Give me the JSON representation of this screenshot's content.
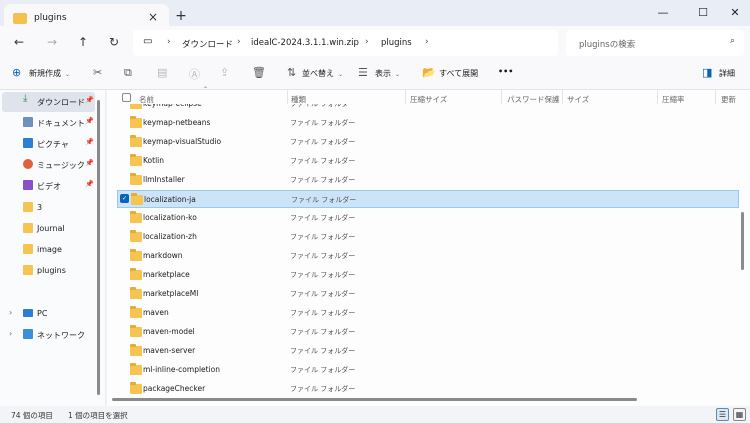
{
  "window": {
    "tab_title": "plugins",
    "tab_close": "×",
    "new_tab": "+",
    "minimize": "—",
    "maximize": "☐",
    "close": "✕"
  },
  "nav": {
    "back": "←",
    "forward": "→",
    "up": "↑",
    "refresh": "↻"
  },
  "address": {
    "crumbs": [
      "ダウンロード",
      "idealC-2024.3.1.1.win.zip",
      "plugins"
    ],
    "search_placeholder": "pluginsの検索"
  },
  "toolbar": {
    "new_label": "新規作成",
    "sort_label": "並べ替え",
    "view_label": "表示",
    "expand_all_label": "すべて展開",
    "more_label": "•••",
    "details_label": "詳細"
  },
  "sidebar": {
    "items": [
      {
        "label": "ダウンロード",
        "pinned": true
      },
      {
        "label": "ドキュメント",
        "pinned": true
      },
      {
        "label": "ピクチャ",
        "pinned": true
      },
      {
        "label": "ミュージック",
        "pinned": true
      },
      {
        "label": "ビデオ",
        "pinned": true
      },
      {
        "label": "3",
        "pinned": false
      },
      {
        "label": "Journal",
        "pinned": false
      },
      {
        "label": "image",
        "pinned": false
      },
      {
        "label": "plugins",
        "pinned": false
      },
      {
        "label": "PC",
        "pinned": false
      },
      {
        "label": "ネットワーク",
        "pinned": false
      }
    ]
  },
  "columns": [
    "名前",
    "種類",
    "圧縮サイズ",
    "パスワード保護",
    "サイズ",
    "圧縮率",
    "更新"
  ],
  "files": [
    {
      "name": "keymap-eclipse",
      "type": "ファイル フォルダー"
    },
    {
      "name": "keymap-netbeans",
      "type": "ファイル フォルダー"
    },
    {
      "name": "keymap-visualStudio",
      "type": "ファイル フォルダー"
    },
    {
      "name": "Kotlin",
      "type": "ファイル フォルダー"
    },
    {
      "name": "llmInstaller",
      "type": "ファイル フォルダー"
    },
    {
      "name": "localization-ja",
      "type": "ファイル フォルダー"
    },
    {
      "name": "localization-ko",
      "type": "ファイル フォルダー"
    },
    {
      "name": "localization-zh",
      "type": "ファイル フォルダー"
    },
    {
      "name": "markdown",
      "type": "ファイル フォルダー"
    },
    {
      "name": "marketplace",
      "type": "ファイル フォルダー"
    },
    {
      "name": "marketplaceMl",
      "type": "ファイル フォルダー"
    },
    {
      "name": "maven",
      "type": "ファイル フォルダー"
    },
    {
      "name": "maven-model",
      "type": "ファイル フォルダー"
    },
    {
      "name": "maven-server",
      "type": "ファイル フォルダー"
    },
    {
      "name": "ml-inline-completion",
      "type": "ファイル フォルダー"
    },
    {
      "name": "packageChecker",
      "type": "ファイル フォルダー"
    }
  ],
  "selected_file": "localization-ja",
  "status": {
    "count": "74 個の項目",
    "selected": "1 個の項目を選択"
  },
  "colors": {
    "accent": "#0b63b8",
    "selection": "#cce4f7",
    "folder": "#f5c451"
  }
}
